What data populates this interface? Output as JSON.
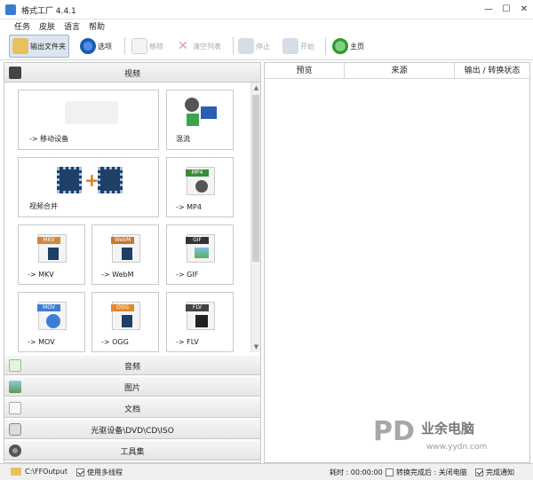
{
  "window": {
    "title": "格式工厂 4.4.1",
    "minimize": "—",
    "maximize": "☐",
    "close": "✕"
  },
  "menu": [
    "任务",
    "皮肤",
    "语言",
    "帮助"
  ],
  "toolbar": {
    "output_folder": "输出文件夹",
    "options": "选项",
    "remove": "移除",
    "clear_list": "清空列表",
    "stop": "停止",
    "start": "开始",
    "home": "主页"
  },
  "categories": {
    "video": "视频",
    "audio": "音频",
    "image": "图片",
    "document": "文档",
    "rom": "光驱设备\\DVD\\CD\\ISO",
    "tools": "工具集"
  },
  "tiles": [
    {
      "label": "-> 移动设备"
    },
    {
      "label": "混流"
    },
    {
      "label": "视频合并"
    },
    {
      "label": "-> MP4",
      "badge": "MP4",
      "badge_color": "#3b8d3b"
    },
    {
      "label": "-> MKV",
      "badge": "MKV",
      "badge_color": "#d2873b"
    },
    {
      "label": "-> WebM",
      "badge": "WebM",
      "badge_color": "#c8782a"
    },
    {
      "label": "-> GIF",
      "badge": "GIF",
      "badge_color": "#333333"
    },
    {
      "label": "-> MOV",
      "badge": "MOV",
      "badge_color": "#3b7fd4"
    },
    {
      "label": "-> OGG",
      "badge": "OGG",
      "badge_color": "#e08a2e"
    },
    {
      "label": "-> FLV",
      "badge": "FLV",
      "badge_color": "#444444"
    }
  ],
  "task_list": {
    "columns": [
      "预览",
      "来源",
      "输出 / 转换状态"
    ]
  },
  "status": {
    "output_path": "C:\\FFOutput",
    "multithread_label": "使用多线程",
    "multithread_checked": true,
    "elapsed": "耗时 : 00:00:00",
    "after_done_label": "转换完成后 : 关闭电脑",
    "after_done_checked": false,
    "notify_label": "完成通知",
    "notify_checked": true
  },
  "watermark": {
    "brand": "业余电脑",
    "url": "www.yydn.com"
  },
  "colors": {
    "accent": "#3b7fd4",
    "toolbar_pressed": "#dde6f0",
    "watermark_red": "#d92c2c"
  }
}
